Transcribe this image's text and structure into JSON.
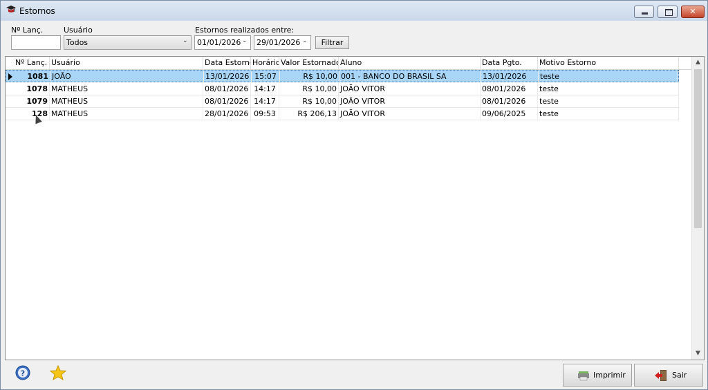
{
  "window": {
    "title": "Estornos",
    "close_glyph": "✕"
  },
  "filters": {
    "lanc_label": "Nº Lanç.",
    "lanc_value": "",
    "usuario_label": "Usuário",
    "usuario_selected": "Todos",
    "date_range_label": "Estornos realizados entre:",
    "date_from": "01/01/2026",
    "date_to": "29/01/2026",
    "filter_button": "Filtrar"
  },
  "grid": {
    "columns": [
      "Nº Lanç.",
      "Usuário",
      "Data Estorno",
      "Horário",
      "Valor Estornado",
      "Aluno",
      "Data Pgto.",
      "Motivo Estorno"
    ],
    "rows": [
      {
        "lanc": "1081",
        "usuario": "JOÃO",
        "data_estorno": "13/01/2026",
        "horario": "15:07",
        "valor": "R$ 10,00",
        "aluno": "001 - BANCO DO BRASIL SA",
        "data_pgto": "13/01/2026",
        "motivo": "teste",
        "selected": true
      },
      {
        "lanc": "1078",
        "usuario": "MATHEUS",
        "data_estorno": "08/01/2026",
        "horario": "14:17",
        "valor": "R$ 10,00",
        "aluno": "JOÃO VITOR",
        "data_pgto": "08/01/2026",
        "motivo": "teste"
      },
      {
        "lanc": "1079",
        "usuario": "MATHEUS",
        "data_estorno": "08/01/2026",
        "horario": "14:17",
        "valor": "R$ 10,00",
        "aluno": "JOÃO VITOR",
        "data_pgto": "08/01/2026",
        "motivo": "teste"
      },
      {
        "lanc": "128",
        "usuario": "MATHEUS",
        "data_estorno": "28/01/2026",
        "horario": "09:53",
        "valor": "R$ 206,13",
        "aluno": "JOÃO VITOR",
        "data_pgto": "09/06/2025",
        "motivo": "teste"
      }
    ]
  },
  "footer": {
    "help_icon": "help-icon",
    "favorite_icon": "star-icon",
    "print_button": "Imprimir",
    "exit_button": "Sair"
  },
  "colors": {
    "selection": "#a9d5f7",
    "titlebar": "#c9d8ea",
    "close_button": "#c6452c"
  }
}
